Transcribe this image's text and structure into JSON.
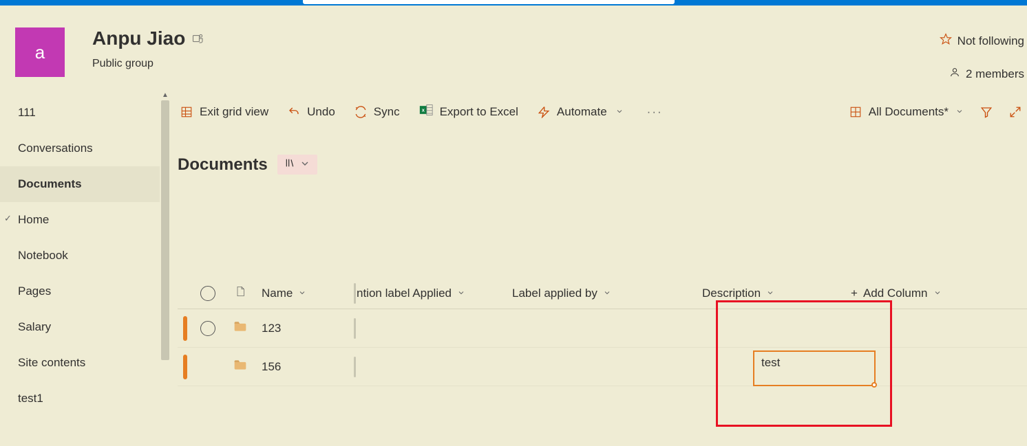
{
  "header": {
    "logo_letter": "a",
    "title": "Anpu Jiao",
    "subtitle": "Public group",
    "follow_label": "Not following",
    "members_label": "2 members"
  },
  "sidebar": {
    "items": [
      {
        "label": "111"
      },
      {
        "label": "Conversations"
      },
      {
        "label": "Documents",
        "active": true
      },
      {
        "label": "Home",
        "home": true
      },
      {
        "label": "Notebook"
      },
      {
        "label": "Pages"
      },
      {
        "label": "Salary"
      },
      {
        "label": "Site contents"
      },
      {
        "label": "test1"
      }
    ]
  },
  "toolbar": {
    "exit_grid": "Exit grid view",
    "undo": "Undo",
    "sync": "Sync",
    "export": "Export to Excel",
    "automate": "Automate",
    "view_name": "All Documents*"
  },
  "page": {
    "title": "Documents"
  },
  "grid": {
    "columns": {
      "name": "Name",
      "retention": "ntion label Applied",
      "label_by": "Label applied by",
      "description": "Description",
      "add": "Add Column",
      "add_plus": "+"
    },
    "rows": [
      {
        "name": "123",
        "selected": true
      },
      {
        "name": "156",
        "selected": false
      }
    ]
  },
  "edit": {
    "value": "test"
  }
}
